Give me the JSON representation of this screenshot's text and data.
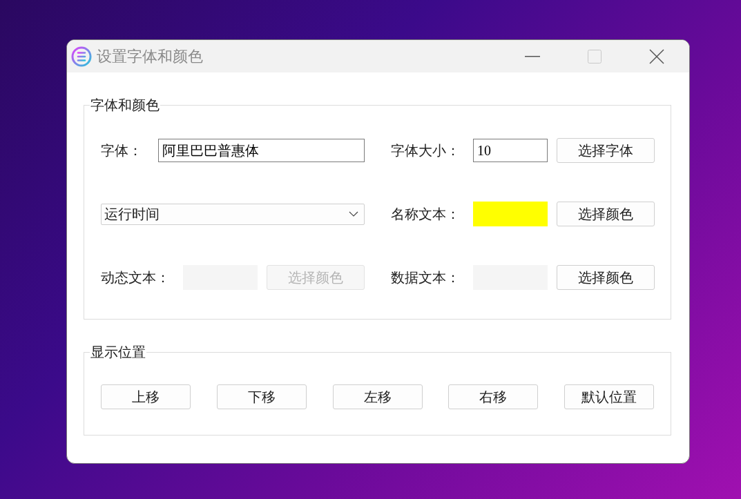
{
  "window": {
    "title": "设置字体和颜色"
  },
  "font_group": {
    "title": "字体和颜色",
    "font_label": "字体：",
    "font_value": "阿里巴巴普惠体",
    "size_label": "字体大小：",
    "size_value": "10",
    "font_button": "选择字体",
    "text_type_select": {
      "value": "运行时间"
    },
    "color_rows": [
      {
        "label": "名称文本：",
        "color": "#ffff00",
        "button": "选择颜色",
        "disabled": false
      },
      {
        "label": "动态文本：",
        "color": "#f5f5f5",
        "button": "选择颜色",
        "disabled": true
      },
      {
        "label": "数据文本：",
        "color": "#f5f5f5",
        "button": "选择颜色",
        "disabled": false
      }
    ]
  },
  "position_group": {
    "title": "显示位置",
    "buttons": [
      "上移",
      "下移",
      "左移",
      "右移",
      "默认位置"
    ]
  }
}
